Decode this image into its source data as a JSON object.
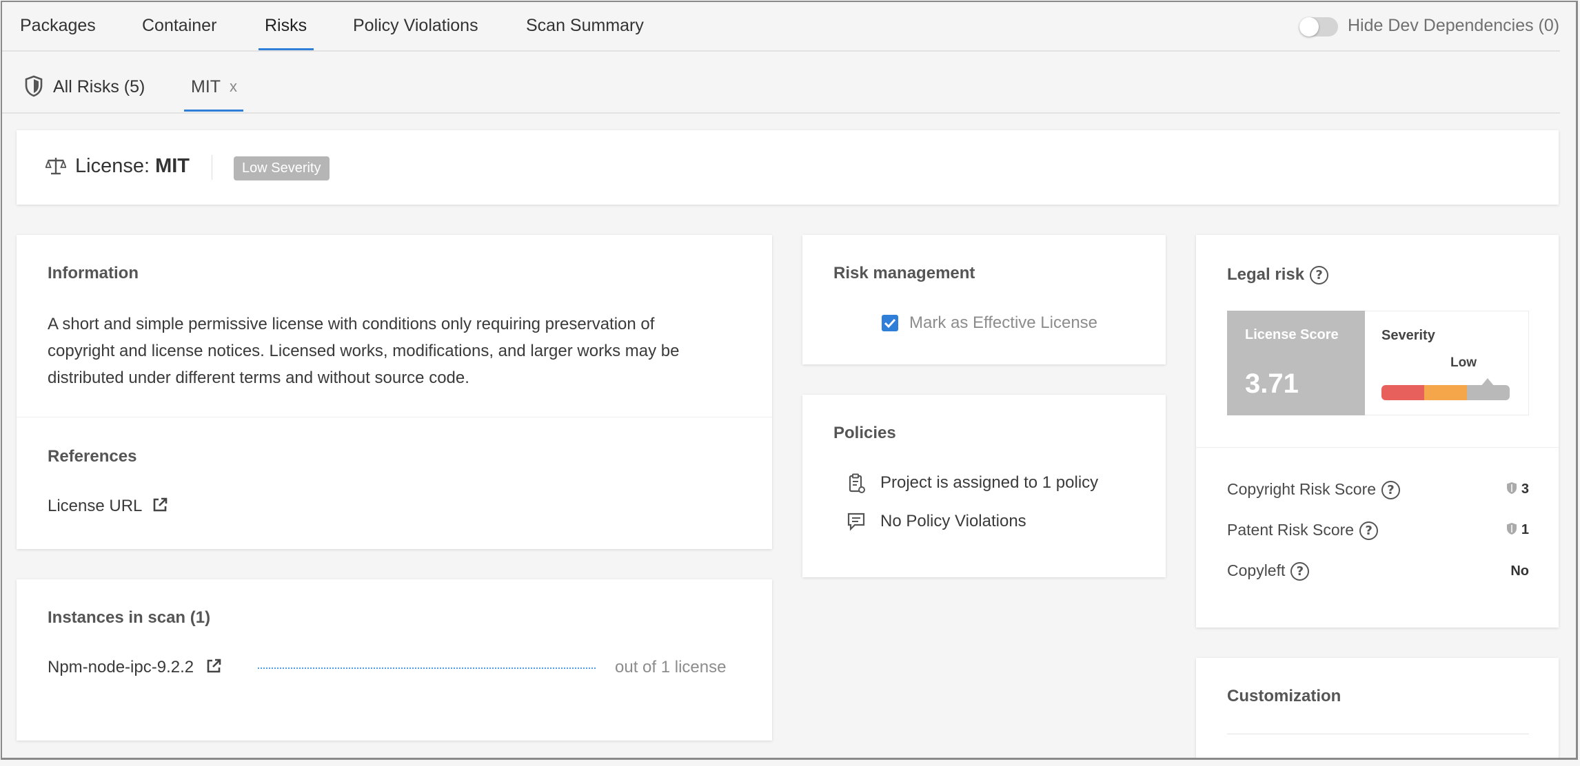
{
  "top_tabs": [
    "Packages",
    "Container",
    "Risks",
    "Policy Violations",
    "Scan Summary"
  ],
  "active_top_tab": "Risks",
  "hide_dev": {
    "label": "Hide Dev Dependencies (0)",
    "enabled": false
  },
  "sub_tabs": {
    "all_risks": "All Risks (5)",
    "active": "MIT",
    "close": "x"
  },
  "header": {
    "prefix": "License: ",
    "name": "MIT",
    "badge": "Low Severity"
  },
  "information": {
    "title": "Information",
    "lines": [
      "A short and simple permissive license with conditions only requiring preservation of",
      "copyright and license notices. Licensed works, modifications, and larger works may be",
      "distributed under different terms and without source code."
    ]
  },
  "references": {
    "title": "References",
    "link": "License URL"
  },
  "instances": {
    "title": "Instances in scan (1)",
    "package": "Npm-node-ipc-9.2.2",
    "note": "out of 1 license"
  },
  "risk_management": {
    "title": "Risk management",
    "checkbox_label": "Mark as Effective License",
    "checked": true
  },
  "policies": {
    "title": "Policies",
    "assigned": "Project is assigned to 1 policy",
    "violations": "No Policy Violations"
  },
  "legal_risk": {
    "title": "Legal risk",
    "score_label": "License Score",
    "score": "3.71",
    "severity_label": "Severity",
    "severity_value": "Low",
    "rows": [
      {
        "label": "Copyright Risk Score",
        "value": "3",
        "shield": true
      },
      {
        "label": "Patent Risk Score",
        "value": "1",
        "shield": true
      },
      {
        "label": "Copyleft",
        "value": "No",
        "shield": false
      }
    ]
  },
  "customization": {
    "title": "Customization"
  },
  "colors": {
    "accent": "#2f7fd8",
    "high": "#e8605c",
    "medium": "#f5a54a",
    "low": "#b9b9b9"
  }
}
